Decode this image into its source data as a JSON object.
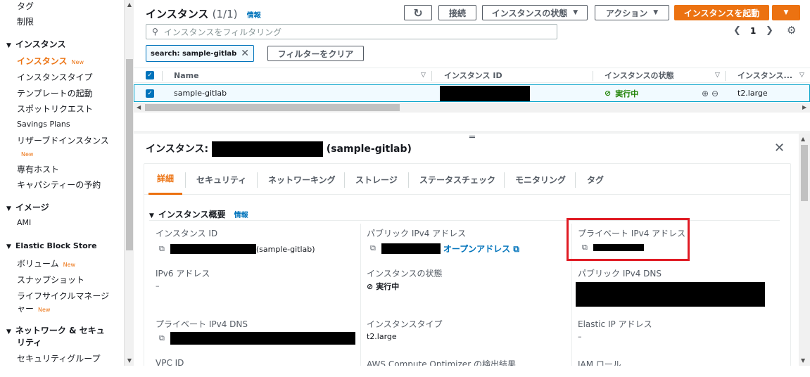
{
  "sidebar": {
    "items_top": [
      "タグ",
      "制限"
    ],
    "sections": [
      {
        "header": "インスタンス",
        "items": [
          {
            "label": "インスタンス",
            "badge": "New",
            "active": true
          },
          {
            "label": "インスタンスタイプ"
          },
          {
            "label": "テンプレートの起動"
          },
          {
            "label": "スポットリクエスト"
          },
          {
            "label": "Savings Plans"
          },
          {
            "label": "リザーブドインスタンス",
            "badge": "New"
          },
          {
            "label": "専有ホスト"
          },
          {
            "label": "キャパシティーの予約"
          }
        ]
      },
      {
        "header": "イメージ",
        "items": [
          {
            "label": "AMI"
          }
        ]
      },
      {
        "header": "Elastic Block Store",
        "items": [
          {
            "label": "ボリューム",
            "badge": "New"
          },
          {
            "label": "スナップショット"
          },
          {
            "label": "ライフサイクルマネージ",
            "label2": "ャー",
            "badge": "New"
          }
        ]
      },
      {
        "header": "ネットワーク & セキュ",
        "header2": "リティ",
        "items": [
          {
            "label": "セキュリティグループ"
          }
        ]
      }
    ]
  },
  "list": {
    "title": "インスタンス",
    "count": "(1/1)",
    "info": "情報",
    "buttons": {
      "refresh": "↻",
      "connect": "接続",
      "state": "インスタンスの状態",
      "actions": "アクション",
      "launch": "インスタンスを起動"
    },
    "filter_placeholder": "インスタンスをフィルタリング",
    "page": "1",
    "token": "search: sample-gitlab",
    "clear_filter": "フィルターをクリア",
    "columns": [
      "Name",
      "インスタンス ID",
      "インスタンスの状態",
      "インスタンス..."
    ],
    "row": {
      "name": "sample-gitlab",
      "state": "実行中",
      "type": "t2.large"
    }
  },
  "detail": {
    "title_prefix": "インスタンス:",
    "title_suffix": "(sample-gitlab)",
    "tabs": [
      "詳細",
      "セキュリティ",
      "ネットワーキング",
      "ストレージ",
      "ステータスチェック",
      "モニタリング",
      "タグ"
    ],
    "section_title": "インスタンス概要",
    "section_info": "情報",
    "fields": {
      "instance_id_label": "インスタンス ID",
      "instance_id_suffix": "(sample-gitlab)",
      "public_ipv4_label": "パブリック IPv4 アドレス",
      "open_address": "オープンアドレス",
      "private_ipv4_label": "プライベート IPv4 アドレス",
      "ipv6_label": "IPv6 アドレス",
      "ipv6_value": "–",
      "state_label": "インスタンスの状態",
      "state_value": "実行中",
      "public_dns_label": "パブリック IPv4 DNS",
      "private_dns_label": "プライベート IPv4 DNS",
      "type_label": "インスタンスタイプ",
      "type_value": "t2.large",
      "eip_label": "Elastic IP アドレス",
      "eip_value": "–",
      "vpc_label": "VPC ID",
      "optimizer_label": "AWS Compute Optimizer の検出結果",
      "iam_label": "IAM ロール"
    }
  },
  "colors": {
    "accent": "#ec7211",
    "link": "#0073bb",
    "running": "#1d8102",
    "highlight": "#e01b24"
  }
}
